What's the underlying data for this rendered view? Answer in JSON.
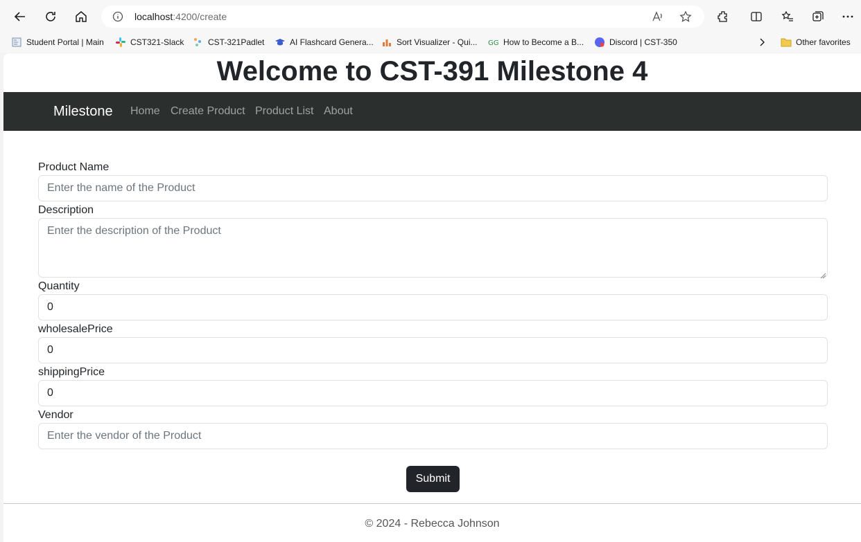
{
  "browser": {
    "url_host": "localhost",
    "url_path": ":4200/create",
    "bookmarks": [
      {
        "label": "Student Portal | Main",
        "icon": "portal-icon"
      },
      {
        "label": "CST321-Slack",
        "icon": "slack-icon"
      },
      {
        "label": "CST-321Padlet",
        "icon": "padlet-icon"
      },
      {
        "label": "AI Flashcard Genera...",
        "icon": "graduation-cap-icon"
      },
      {
        "label": "Sort Visualizer - Qui...",
        "icon": "bar-chart-icon"
      },
      {
        "label": "How to Become a B...",
        "icon": "geeksforgeeks-icon"
      },
      {
        "label": "Discord | CST-350",
        "icon": "discord-icon"
      }
    ],
    "other_favorites": "Other favorites"
  },
  "page": {
    "title": "Welcome to CST-391 Milestone 4",
    "navbar": {
      "brand": "Milestone",
      "links": [
        "Home",
        "Create Product",
        "Product List",
        "About"
      ]
    },
    "form": {
      "name_label": "Product Name",
      "name_placeholder": "Enter the name of the Product",
      "desc_label": "Description",
      "desc_placeholder": "Enter the description of the Product",
      "qty_label": "Quantity",
      "qty_value": "0",
      "wholesale_label": "wholesalePrice",
      "wholesale_value": "0",
      "shipping_label": "shippingPrice",
      "shipping_value": "0",
      "vendor_label": "Vendor",
      "vendor_placeholder": "Enter the vendor of the Product",
      "submit_label": "Submit"
    },
    "footer": "© 2024 - Rebecca Johnson"
  }
}
